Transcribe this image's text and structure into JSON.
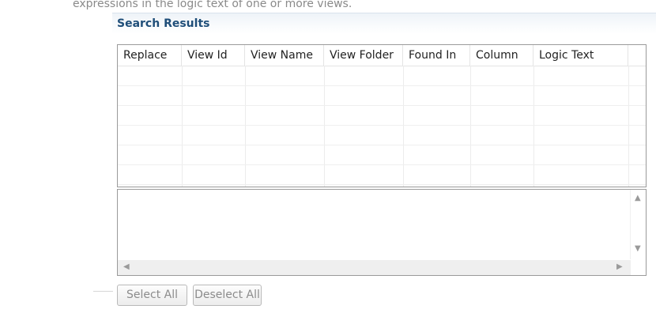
{
  "description": "expressions in the logic text of one or more views.",
  "section": {
    "title": "Search Results"
  },
  "table": {
    "columns": [
      "Replace",
      "View Id",
      "View Name",
      "View Folder",
      "Found In",
      "Column",
      "Logic Text"
    ],
    "rows": []
  },
  "buttons": {
    "select_all": "Select All",
    "deselect_all": "Deselect All"
  },
  "icons": {
    "scroll_up": "triangle-up",
    "scroll_down": "triangle-down",
    "scroll_left": "triangle-left",
    "scroll_right": "triangle-right"
  },
  "colors": {
    "section_title": "#1f4e79",
    "border": "#9a9a9a"
  }
}
